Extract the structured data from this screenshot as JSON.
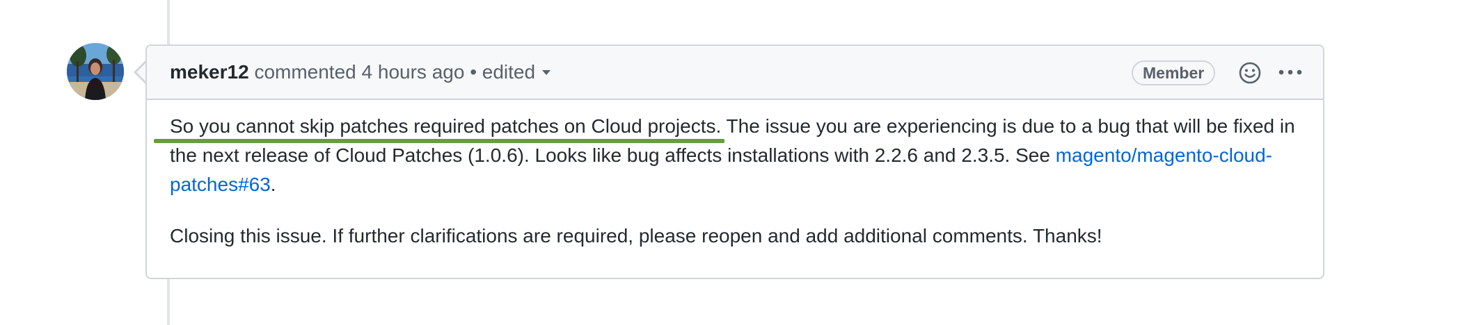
{
  "comment": {
    "author": "meker12",
    "action": "commented",
    "time": "4 hours ago",
    "separator": "•",
    "edited_label": "edited",
    "role_badge": "Member",
    "icons": {
      "emoji": "smiley-icon",
      "more": "kebab-horizontal-icon",
      "edited_menu": "caret-down-icon"
    },
    "body": {
      "paragraph1": {
        "highlighted": "So you cannot skip patches required patches on Cloud projects.",
        "rest": " The issue you are experiencing is due to a bug that will be fixed in the next release of Cloud Patches (1.0.6). Looks like bug affects installations with 2.2.6 and 2.3.5. See ",
        "link_text": "magento/magento-cloud-patches#63",
        "trailing": "."
      },
      "paragraph2": "Closing this issue. If further clarifications are required, please reopen and add additional comments. Thanks!"
    }
  },
  "colors": {
    "link": "#0366d6",
    "underline_annotation": "#6a9c3a",
    "header_bg": "#f6f8fa",
    "border": "#d1d5da"
  }
}
